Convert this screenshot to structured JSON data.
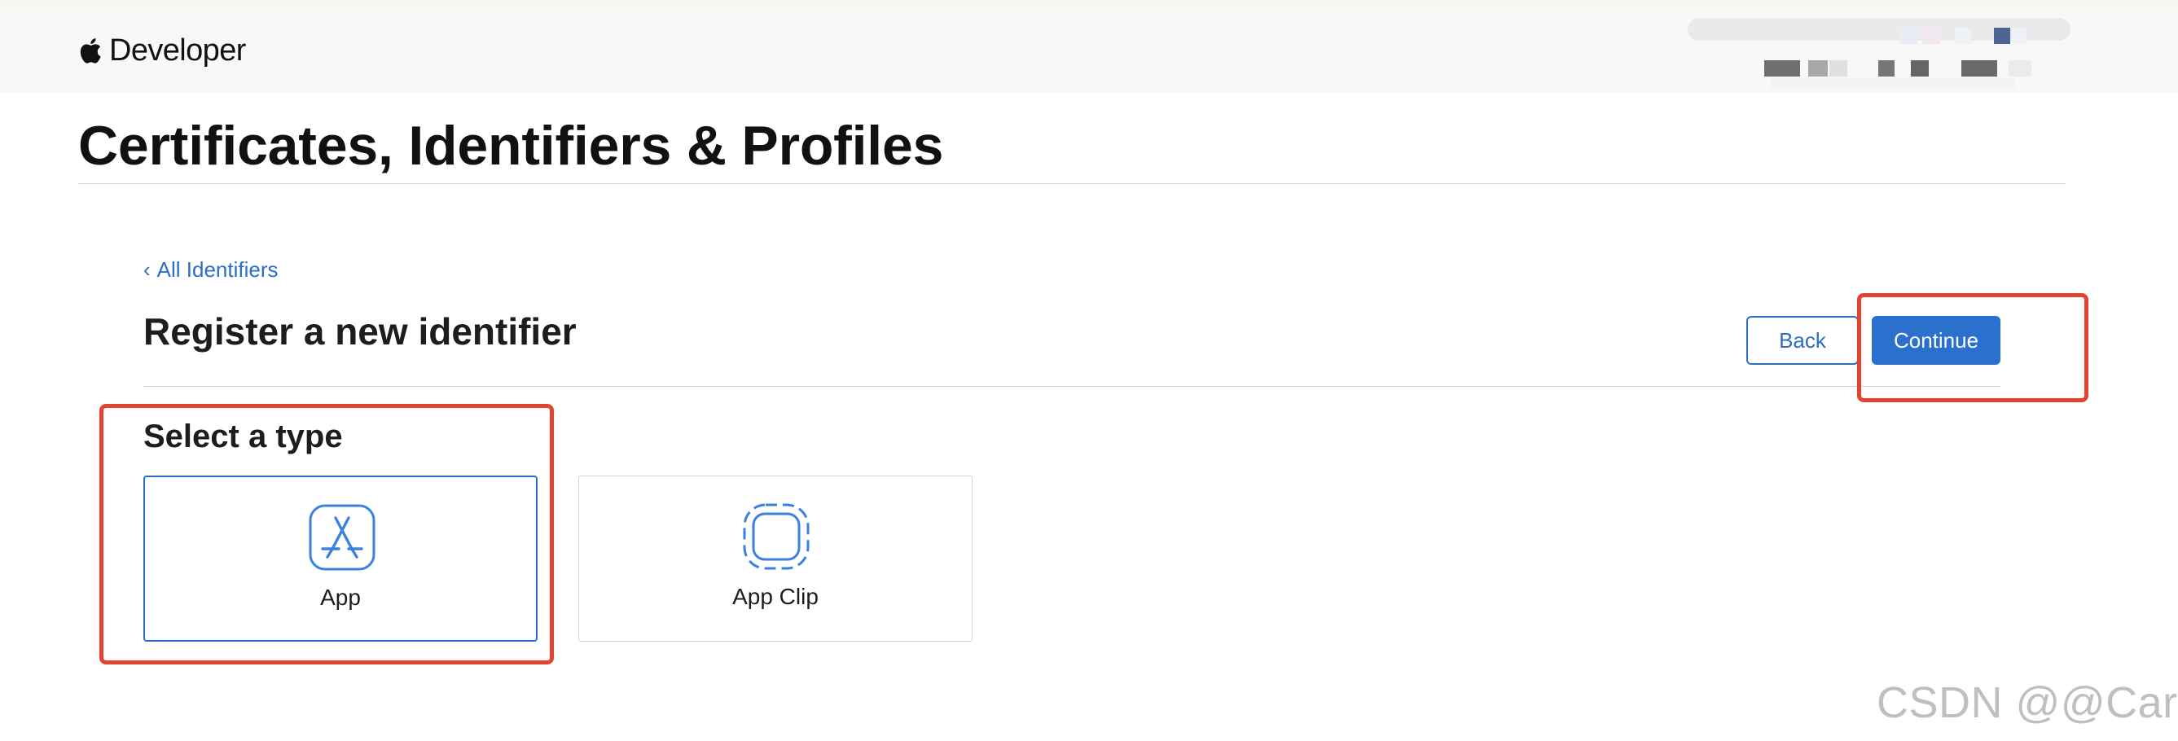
{
  "header": {
    "brand": "Developer"
  },
  "page": {
    "title": "Certificates, Identifiers & Profiles"
  },
  "breadcrumb": {
    "label": "All Identifiers"
  },
  "section": {
    "title": "Register a new identifier"
  },
  "actions": {
    "back_label": "Back",
    "continue_label": "Continue"
  },
  "type_select": {
    "heading": "Select a type",
    "options": [
      {
        "label": "App",
        "icon": "app-store-icon",
        "selected": true
      },
      {
        "label": "App Clip",
        "icon": "app-clip-icon",
        "selected": false
      }
    ]
  },
  "watermark": "CSDN @@Carey",
  "colors": {
    "accent": "#2b70cc",
    "highlight": "#e2442f",
    "divider": "#d2d2d7"
  }
}
